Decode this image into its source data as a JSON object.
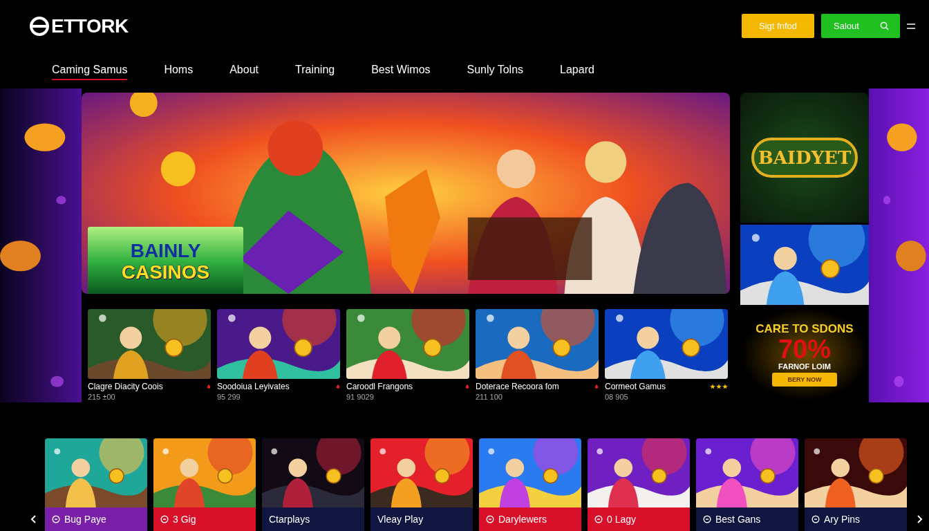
{
  "header": {
    "logo": "ETTORK",
    "buttons": [
      {
        "label": "Sigt fnfod",
        "kind": "signup"
      },
      {
        "label": "Salout",
        "kind": "search"
      }
    ]
  },
  "nav": [
    {
      "label": "Caming Samus",
      "selected": true
    },
    {
      "label": "Homs",
      "selected": false
    },
    {
      "label": "About",
      "selected": false
    },
    {
      "label": "Training",
      "selected": false
    },
    {
      "label": "Best Wimos",
      "selected": false
    },
    {
      "label": "Sunly Tolns",
      "selected": false
    },
    {
      "label": "Lapard",
      "selected": false
    }
  ],
  "hero": {
    "kind": "picture",
    "badge": [
      "BAINLY",
      "CASINOS"
    ]
  },
  "side": {
    "logo": "BAIDYET",
    "promo": {
      "title": "CARE TO SDONS",
      "percent": "70%",
      "subtitle": "FARNOF LOIM",
      "button": "BERY NOW"
    }
  },
  "games": [
    {
      "title": "Clagre Diacity Coois",
      "count": "215 ±00",
      "kind": "mark"
    },
    {
      "title": "Soodoiua Leyivates",
      "count": "95 299",
      "kind": "mark"
    },
    {
      "title": "Caroodl Frangons",
      "count": "91 9029",
      "kind": "mark"
    },
    {
      "title": "Doterace Recoora fom",
      "count": "211 100",
      "kind": "mark"
    },
    {
      "title": "Cormeot Gamus",
      "count": "08 905",
      "kind": "stars",
      "stars": 3
    }
  ],
  "tiles": [
    {
      "label": "Bug Paye",
      "color": "#7a1fa8",
      "kind": "icon"
    },
    {
      "label": "3 Gig",
      "color": "#d8102a",
      "kind": "icon"
    },
    {
      "label": "Ctarplays",
      "color": "#10163f",
      "kind": "plain"
    },
    {
      "label": "Vleay Play",
      "color": "#10163f",
      "kind": "plain"
    },
    {
      "label": "Darylewers",
      "color": "#d8102a",
      "kind": "icon"
    },
    {
      "label": "0 Lagy",
      "color": "#d8102a",
      "kind": "icon"
    },
    {
      "label": "Best Gans",
      "color": "#10163f",
      "kind": "icon"
    },
    {
      "label": "Ary Pins",
      "color": "#10163f",
      "kind": "icon"
    }
  ]
}
